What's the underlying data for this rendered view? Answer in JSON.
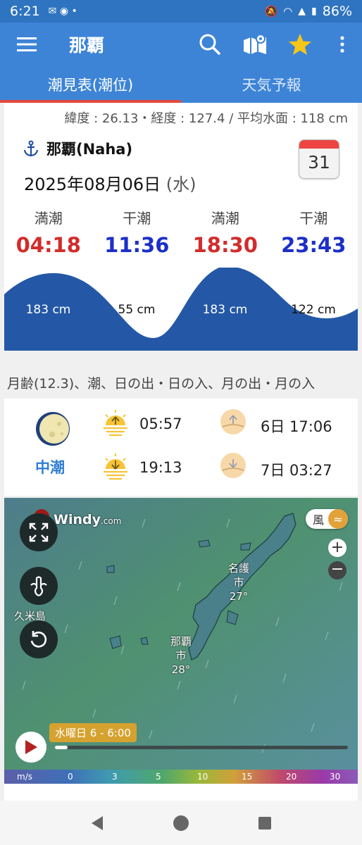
{
  "status": {
    "time": "6:21",
    "battery": "86%"
  },
  "appbar": {
    "title": "那覇"
  },
  "tabs": [
    {
      "label": "潮見表(潮位)"
    },
    {
      "label": "天気予報"
    }
  ],
  "location": {
    "coords": "緯度 : 26.13・経度 : 127.4 / 平均水面 : 118 cm",
    "name": "那覇(Naha)",
    "date": "2025年08月06日",
    "weekday": "(水)",
    "calendar_day": "31"
  },
  "tides": [
    {
      "kind": "満潮",
      "time": "04:18",
      "level": "183 cm",
      "type": "high"
    },
    {
      "kind": "干潮",
      "time": "11:36",
      "level": "55 cm",
      "type": "low"
    },
    {
      "kind": "満潮",
      "time": "18:30",
      "level": "183 cm",
      "type": "high"
    },
    {
      "kind": "干潮",
      "time": "23:43",
      "level": "122 cm",
      "type": "low"
    }
  ],
  "astro": {
    "section_title": "月齢(12.3)、潮、日の出・日の入、月の出・月の入",
    "tide_name": "中潮",
    "sunrise": "05:57",
    "sunset": "19:13",
    "moonrise": "6日 17:06",
    "moonset": "7日 03:27"
  },
  "map": {
    "brand": "Windy",
    "brand_suffix": ".com",
    "layer": "風",
    "city1": "名護",
    "city1_suffix": "市",
    "city1_temp": "27°",
    "city2": "那覇",
    "city2_suffix": "市",
    "city2_temp": "28°",
    "island_label": "久米島",
    "timeline_label": "水曜日 6 - 6:00",
    "scale_unit": "m/s",
    "scale": [
      "0",
      "3",
      "5",
      "10",
      "15",
      "20",
      "30"
    ]
  },
  "colors": {
    "primary": "#3d84d6",
    "status": "#2f74c0",
    "high": "#d22c2c",
    "low": "#1c2fc9",
    "wave": "#2458a6",
    "tab_indicator": "#e3493a"
  }
}
